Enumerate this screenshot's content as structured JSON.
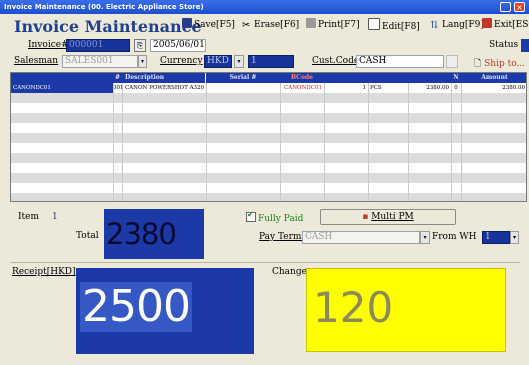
{
  "window": {
    "title": "Invoice Maintenance (00. Electric Appliance Store)",
    "controls": {
      "minimize": "_",
      "close": "×"
    }
  },
  "app": {
    "title": "Invoice Maintenance"
  },
  "toolbar": {
    "save": "Save[F5]",
    "erase": "Erase[F6]",
    "print": "Print[F7]",
    "edit": "Edit[F8]",
    "lang": "Lang[F9]",
    "exit": "Exit[ESC"
  },
  "header": {
    "invoice_label": "Invoice#",
    "invoice_value": "000001",
    "date_value": "2005/06/01",
    "status_label": "Status",
    "salesman_label": "Salesman",
    "salesman_value": "SALES001",
    "currency_label": "Currency",
    "currency_value": "HKD",
    "rate_value": "1",
    "cust_code_label": "Cust.Code",
    "cust_code_value": "CASH",
    "ship_to": "Ship to..."
  },
  "grid": {
    "columns": [
      "",
      "#",
      "Description",
      "Serial #",
      "BCode",
      "",
      "",
      "",
      "N",
      "Amount"
    ],
    "rows": [
      {
        "code": "CANONDC01",
        "num": "001",
        "desc": "CANON POWERSHOT A320",
        "serial": "",
        "bcode": "CANONDC01",
        "qty": "1",
        "unit": "PCS",
        "price": "2380.00",
        "n": "0",
        "amount": "2380.00"
      }
    ]
  },
  "summary": {
    "item_label": "Item",
    "item_count": "1",
    "total_label": "Total",
    "total_value": "2380",
    "fully_paid_label": "Fully Paid",
    "fully_paid_checked": true,
    "multi_pm_label": "Multi PM",
    "pay_terms_label": "Pay Terms",
    "pay_terms_value": "CASH",
    "from_wh_label": "From WH",
    "from_wh_value": "1",
    "receipt_label": "Receipt[HKD]",
    "receipt_value": "2500",
    "change_label": "Change",
    "change_value": "120"
  },
  "colors": {
    "accent_blue": "#1b3aa8",
    "change_yellow": "#ffff00",
    "title_blue": "#1f3f8f"
  }
}
